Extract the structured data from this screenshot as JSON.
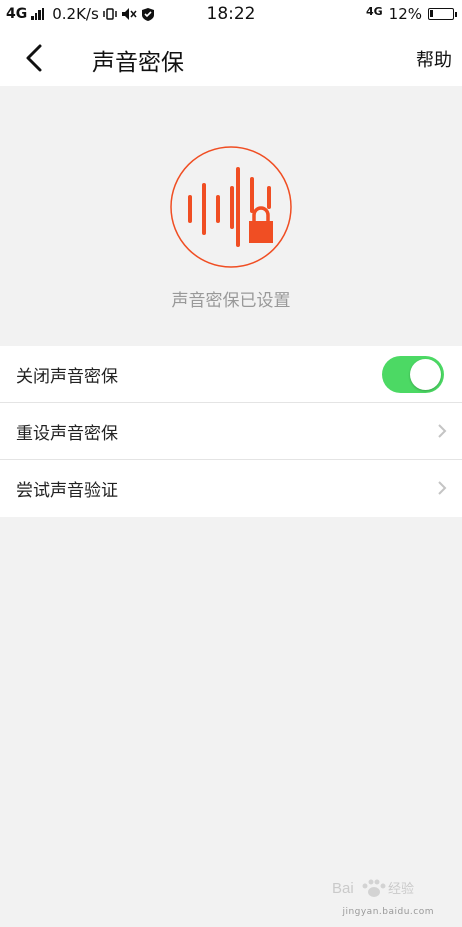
{
  "status_bar": {
    "network": "4G",
    "speed": "0.2K/s",
    "time": "18:22",
    "network_right": "4G",
    "battery": "12%",
    "battery_level": 0.12
  },
  "header": {
    "title": "声音密保",
    "help_label": "帮助"
  },
  "hero": {
    "status_text": "声音密保已设置",
    "accent_color": "#f04e23"
  },
  "settings": {
    "items": [
      {
        "label": "关闭声音密保",
        "control": "toggle",
        "on": true
      },
      {
        "label": "重设声音密保",
        "control": "chevron"
      },
      {
        "label": "尝试声音验证",
        "control": "chevron"
      }
    ],
    "toggle_color": "#4cd964"
  },
  "watermark": {
    "logo_text": "Baidu经验",
    "url": "jingyan.baidu.com"
  }
}
